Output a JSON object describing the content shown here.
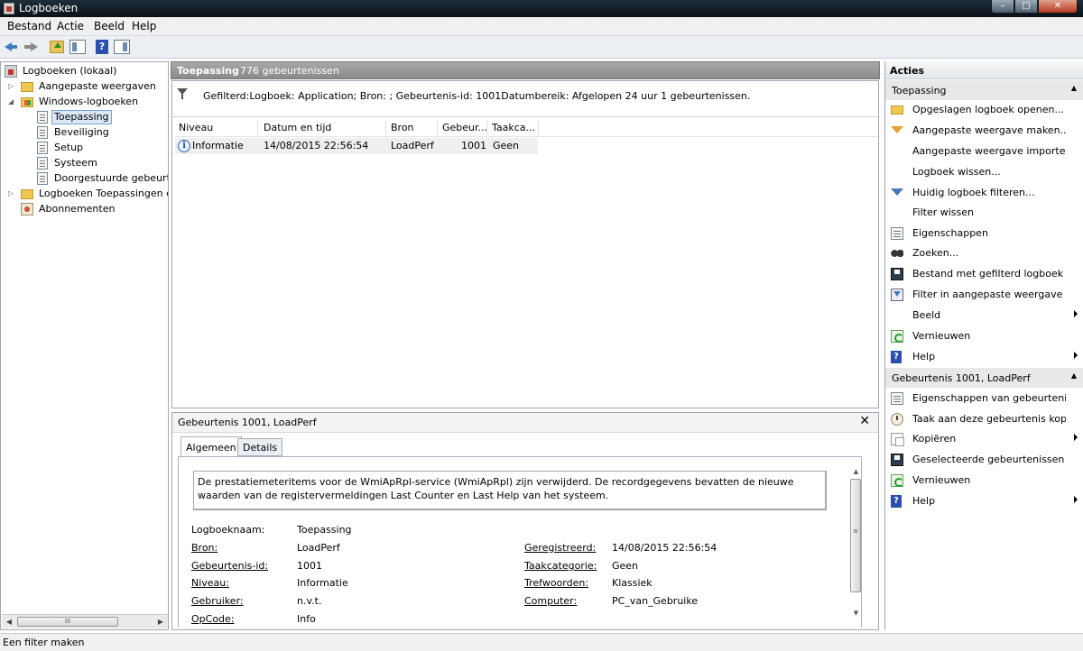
{
  "window": {
    "title": "Logboeken",
    "controls": {
      "minimize": "–",
      "maximize": "□",
      "close": "✕"
    }
  },
  "menu": [
    "Bestand",
    "Actie",
    "Beeld",
    "Help"
  ],
  "toolbar": {
    "help_glyph": "?"
  },
  "tree": [
    {
      "label": "Logboeken (lokaal)",
      "icon": "event-viewer-icon"
    },
    {
      "label": "Aangepaste weergaven",
      "icon": "folder-icon",
      "expander": "▷"
    },
    {
      "label": "Windows-logboeken",
      "icon": "folder-icon",
      "expander": "◢"
    },
    {
      "label": "Toepassing",
      "icon": "log-icon",
      "selected": true
    },
    {
      "label": "Beveiliging",
      "icon": "log-icon"
    },
    {
      "label": "Setup",
      "icon": "log-icon"
    },
    {
      "label": "Systeem",
      "icon": "log-icon"
    },
    {
      "label": "Doorgestuurde gebeurtenissen",
      "icon": "log-icon"
    },
    {
      "label": "Logboeken Toepassingen en services",
      "icon": "folder-icon",
      "expander": "▷"
    },
    {
      "label": "Abonnementen",
      "icon": "subscription-icon"
    }
  ],
  "hscroll": {
    "left": "◀",
    "right": "▶",
    "grip": "III"
  },
  "center": {
    "log_name": "Toepassing",
    "event_count": "776 gebeurtenissen",
    "filter_text": "Gefilterd:Logboek: Application; Bron: ; Gebeurtenis-id: 1001Datumbereik: Afgelopen 24 uur 1 gebeurtenissen.",
    "columns": [
      "Niveau",
      "Datum en tijd",
      "Bron",
      "Gebeur...",
      "Taakca..."
    ],
    "rows": [
      {
        "level": "Informatie",
        "date": "14/08/2015 22:56:54",
        "source": "LoadPerf",
        "id": "1001",
        "task": "Geen"
      }
    ]
  },
  "detail": {
    "title": "Gebeurtenis 1001, LoadPerf",
    "close": "✕",
    "tabs": [
      "Algemeen",
      "Details"
    ],
    "description": "De prestatiemeteritems voor de WmiApRpl-service (WmiApRpl) zijn verwijderd. De recordgegevens bevatten de nieuwe waarden van de registervermeldingen Last Counter en Last Help van het systeem.",
    "props": {
      "logname": {
        "label": "Logboeknaam:",
        "value": "Toepassing"
      },
      "source": {
        "label": "Bron:",
        "value": "LoadPerf"
      },
      "event_id": {
        "label": "Gebeurtenis-id:",
        "value": "1001"
      },
      "level": {
        "label": "Niveau:",
        "value": "Informatie"
      },
      "user": {
        "label": "Gebruiker:",
        "value": "n.v.t."
      },
      "opcode": {
        "label": "OpCode:",
        "value": "Info"
      },
      "logged": {
        "label": "Geregistreerd:",
        "value": "14/08/2015 22:56:54"
      },
      "task_category": {
        "label": "Taakcategorie:",
        "value": "Geen"
      },
      "keywords": {
        "label": "Trefwoorden:",
        "value": "Klassiek"
      },
      "computer": {
        "label": "Computer:",
        "value": "PC_van_Gebruike"
      }
    },
    "vscroll": {
      "up": "▲",
      "down": "▼",
      "grip": "≡"
    }
  },
  "actions": {
    "title": "Acties",
    "collapse_glyph": "▲",
    "section1": {
      "title": "Toepassing",
      "items": [
        {
          "label": "Opgeslagen logboek openen...",
          "icon": "open-folder-icon"
        },
        {
          "label": "Aangepaste weergave maken...",
          "icon": "filter-icon"
        },
        {
          "label": "Aangepaste weergave importer...",
          "icon": ""
        },
        {
          "label": "Logboek wissen...",
          "icon": ""
        },
        {
          "label": "Huidig logboek filteren...",
          "icon": "filter-icon"
        },
        {
          "label": "Filter wissen",
          "icon": ""
        },
        {
          "label": "Eigenschappen",
          "icon": "properties-icon"
        },
        {
          "label": "Zoeken...",
          "icon": "find-icon"
        },
        {
          "label": "Bestand met gefilterd logboek o...",
          "icon": "save-icon"
        },
        {
          "label": "Filter in aangepaste weergave o...",
          "icon": "filter-view-icon"
        },
        {
          "label": "Beeld",
          "icon": "",
          "submenu": true
        },
        {
          "label": "Vernieuwen",
          "icon": "refresh-icon"
        },
        {
          "label": "Help",
          "icon": "help-icon",
          "submenu": true
        }
      ]
    },
    "section2": {
      "title": "Gebeurtenis 1001, LoadPerf",
      "items": [
        {
          "label": "Eigenschappen van gebeurtenis",
          "icon": "properties-icon"
        },
        {
          "label": "Taak aan deze gebeurtenis kopp...",
          "icon": "task-icon"
        },
        {
          "label": "Kopiëren",
          "icon": "copy-icon",
          "submenu": true
        },
        {
          "label": "Geselecteerde gebeurtenissen o...",
          "icon": "save-icon"
        },
        {
          "label": "Vernieuwen",
          "icon": "refresh-icon"
        },
        {
          "label": "Help",
          "icon": "help-icon",
          "submenu": true
        }
      ]
    }
  },
  "status": {
    "text": "Een filter maken"
  }
}
